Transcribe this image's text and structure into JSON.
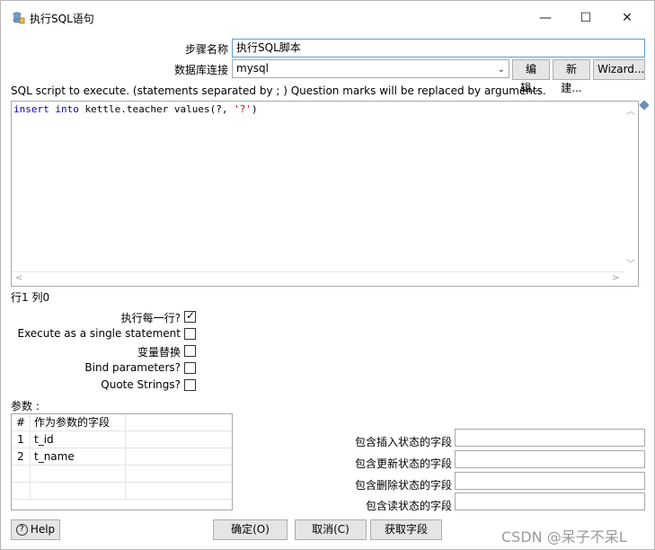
{
  "window": {
    "title": "执行SQL语句",
    "min_label": "—",
    "max_label": "☐",
    "close_label": "✕"
  },
  "form": {
    "step_name_label": "步骤名称",
    "step_name_value": "执行SQL脚本",
    "connection_label": "数据库连接",
    "connection_value": "mysql",
    "edit_button": "编辑...",
    "new_button": "新建...",
    "wizard_button": "Wizard..."
  },
  "sql": {
    "header": "SQL script to execute. (statements separated by ; ) Question marks will be replaced by arguments.",
    "code_kw1": "insert",
    "code_kw2": "into",
    "code_mid": "kettle.teacher values(?, ",
    "code_str": "'?'",
    "code_end": ")",
    "position": "行1 列0"
  },
  "options": {
    "execute_each_row": {
      "label": "执行每一行?",
      "checked": true
    },
    "single_statement": {
      "label": "Execute as a single statement",
      "checked": false
    },
    "variable_substitution": {
      "label": "变量替换",
      "checked": false
    },
    "bind_parameters": {
      "label": "Bind parameters?",
      "checked": false
    },
    "quote_strings": {
      "label": "Quote Strings?",
      "checked": false
    }
  },
  "params": {
    "label": "参数 :",
    "col_num": "#",
    "col_field": "作为参数的字段",
    "rows": [
      {
        "num": "1",
        "field": "t_id"
      },
      {
        "num": "2",
        "field": "t_name"
      }
    ]
  },
  "status_fields": {
    "insert_label": "包含插入状态的字段",
    "update_label": "包含更新状态的字段",
    "delete_label": "包含删除状态的字段",
    "read_label": "包含读状态的字段"
  },
  "footer": {
    "help": "Help",
    "ok": "确定(O)",
    "cancel": "取消(C)",
    "get_fields": "获取字段"
  },
  "watermark": "CSDN @呆子不呆L"
}
